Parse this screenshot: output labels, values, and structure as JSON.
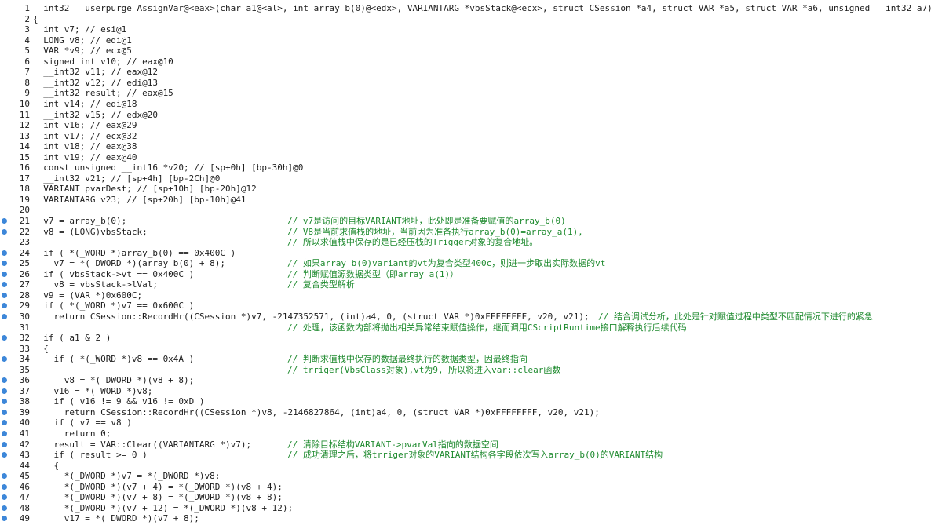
{
  "lines": [
    {
      "n": "1",
      "dot": false,
      "code": "__int32 __userpurge AssignVar@<eax>(char a1@<al>, int array_b(0)@<edx>, VARIANTARG *vbsStack@<ecx>, struct CSession *a4, struct VAR *a5, struct VAR *a6, unsigned __int32 a7)",
      "comment": ""
    },
    {
      "n": "2",
      "dot": false,
      "code": "{",
      "comment": ""
    },
    {
      "n": "3",
      "dot": false,
      "code": "  int v7; // esi@1",
      "comment": ""
    },
    {
      "n": "4",
      "dot": false,
      "code": "  LONG v8; // edi@1",
      "comment": ""
    },
    {
      "n": "5",
      "dot": false,
      "code": "  VAR *v9; // ecx@5",
      "comment": ""
    },
    {
      "n": "6",
      "dot": false,
      "code": "  signed int v10; // eax@10",
      "comment": ""
    },
    {
      "n": "7",
      "dot": false,
      "code": "  __int32 v11; // eax@12",
      "comment": ""
    },
    {
      "n": "8",
      "dot": false,
      "code": "  __int32 v12; // edi@13",
      "comment": ""
    },
    {
      "n": "9",
      "dot": false,
      "code": "  __int32 result; // eax@15",
      "comment": ""
    },
    {
      "n": "10",
      "dot": false,
      "code": "  int v14; // edi@18",
      "comment": ""
    },
    {
      "n": "11",
      "dot": false,
      "code": "  __int32 v15; // edx@20",
      "comment": ""
    },
    {
      "n": "12",
      "dot": false,
      "code": "  int v16; // eax@29",
      "comment": ""
    },
    {
      "n": "13",
      "dot": false,
      "code": "  int v17; // ecx@32",
      "comment": ""
    },
    {
      "n": "14",
      "dot": false,
      "code": "  int v18; // eax@38",
      "comment": ""
    },
    {
      "n": "15",
      "dot": false,
      "code": "  int v19; // eax@40",
      "comment": ""
    },
    {
      "n": "16",
      "dot": false,
      "code": "  const unsigned __int16 *v20; // [sp+0h] [bp-30h]@0",
      "comment": ""
    },
    {
      "n": "17",
      "dot": false,
      "code": "  __int32 v21; // [sp+4h] [bp-2Ch]@0",
      "comment": ""
    },
    {
      "n": "18",
      "dot": false,
      "code": "  VARIANT pvarDest; // [sp+10h] [bp-20h]@12",
      "comment": ""
    },
    {
      "n": "19",
      "dot": false,
      "code": "  VARIANTARG v23; // [sp+20h] [bp-10h]@41",
      "comment": ""
    },
    {
      "n": "20",
      "dot": false,
      "code": "",
      "comment": ""
    },
    {
      "n": "21",
      "dot": true,
      "code": "  v7 = array_b(0);",
      "comment": "// v7是访问的目标VARIANT地址，此处即是准备要赋值的array_b(0)"
    },
    {
      "n": "22",
      "dot": true,
      "code": "  v8 = (LONG)vbsStack;",
      "comment": "// V8是当前求值栈的地址，当前因为准备执行array_b(0)=array_a(1),"
    },
    {
      "n": "23",
      "dot": false,
      "code": "",
      "comment": "// 所以求值栈中保存的是已经压栈的Trigger对象的复合地址。"
    },
    {
      "n": "24",
      "dot": true,
      "code": "  if ( *(_WORD *)array_b(0) == 0x400C )",
      "comment": ""
    },
    {
      "n": "25",
      "dot": true,
      "code": "    v7 = *(_DWORD *)(array_b(0) + 8);",
      "comment": "// 如果array_b(0)variant的vt为复合类型400c，则进一步取出实际数据的vt"
    },
    {
      "n": "26",
      "dot": true,
      "code": "  if ( vbsStack->vt == 0x400C )",
      "comment": "// 判断赋值源数据类型（即array_a(1)）"
    },
    {
      "n": "27",
      "dot": true,
      "code": "    v8 = vbsStack->lVal;",
      "comment": "// 复合类型解析"
    },
    {
      "n": "28",
      "dot": true,
      "code": "  v9 = (VAR *)0x600C;",
      "comment": ""
    },
    {
      "n": "29",
      "dot": true,
      "code": "  if ( *(_WORD *)v7 == 0x600C )",
      "comment": ""
    },
    {
      "n": "30",
      "dot": true,
      "code": "    return CSession::RecordHr((CSession *)v7, -2147352571, (int)a4, 0, (struct VAR *)0xFFFFFFFF, v20, v21);",
      "comment": ""
    },
    {
      "n": "31",
      "dot": false,
      "code": "",
      "comment": "// 处理，该函数内部将抛出相关异常结束赋值操作，继而调用CScriptRuntime接口解释执行后续代码"
    },
    {
      "n": "32",
      "dot": true,
      "code": "  if ( a1 & 2 )",
      "comment": ""
    },
    {
      "n": "33",
      "dot": false,
      "code": "  {",
      "comment": ""
    },
    {
      "n": "34",
      "dot": true,
      "code": "    if ( *(_WORD *)v8 == 0x4A )",
      "comment": "// 判断求值栈中保存的数据最终执行的数据类型，因最终指向"
    },
    {
      "n": "35",
      "dot": false,
      "code": "",
      "comment": "// trriger(VbsClass对象),vt为9, 所以将进入var::clear函数"
    },
    {
      "n": "36",
      "dot": true,
      "code": "      v8 = *(_DWORD *)(v8 + 8);",
      "comment": ""
    },
    {
      "n": "37",
      "dot": true,
      "code": "    v16 = *(_WORD *)v8;",
      "comment": ""
    },
    {
      "n": "38",
      "dot": true,
      "code": "    if ( v16 != 9 && v16 != 0xD )",
      "comment": ""
    },
    {
      "n": "39",
      "dot": true,
      "code": "      return CSession::RecordHr((CSession *)v8, -2146827864, (int)a4, 0, (struct VAR *)0xFFFFFFFF, v20, v21);",
      "comment": ""
    },
    {
      "n": "40",
      "dot": true,
      "code": "    if ( v7 == v8 )",
      "comment": ""
    },
    {
      "n": "41",
      "dot": true,
      "code": "      return 0;",
      "comment": ""
    },
    {
      "n": "42",
      "dot": true,
      "code": "    result = VAR::Clear((VARIANTARG *)v7);",
      "comment": "// 清除目标结构VARIANT->pvarVal指向的数据空间"
    },
    {
      "n": "43",
      "dot": true,
      "code": "    if ( result >= 0 )",
      "comment": "// 成功清理之后，将trriger对象的VARIANT结构各字段依次写入array_b(0)的VARIANT结构"
    },
    {
      "n": "44",
      "dot": false,
      "code": "    {",
      "comment": ""
    },
    {
      "n": "45",
      "dot": true,
      "code": "      *(_DWORD *)v7 = *(_DWORD *)v8;",
      "comment": ""
    },
    {
      "n": "46",
      "dot": true,
      "code": "      *(_DWORD *)(v7 + 4) = *(_DWORD *)(v8 + 4);",
      "comment": ""
    },
    {
      "n": "47",
      "dot": true,
      "code": "      *(_DWORD *)(v7 + 8) = *(_DWORD *)(v8 + 8);",
      "comment": ""
    },
    {
      "n": "48",
      "dot": true,
      "code": "      *(_DWORD *)(v7 + 12) = *(_DWORD *)(v8 + 12);",
      "comment": ""
    },
    {
      "n": "49",
      "dot": true,
      "code": "      v17 = *(_DWORD *)(v7 + 8);",
      "comment": ""
    }
  ],
  "line30_trailing_comment": "// 结合调试分析，此处是针对赋值过程中类型不匹配情况下进行的紧急",
  "colors": {
    "comment_green": "#1e8a2e",
    "breakpoint_dot": "#3d87d9",
    "inline_comment_blue": "#3b8fd8"
  }
}
